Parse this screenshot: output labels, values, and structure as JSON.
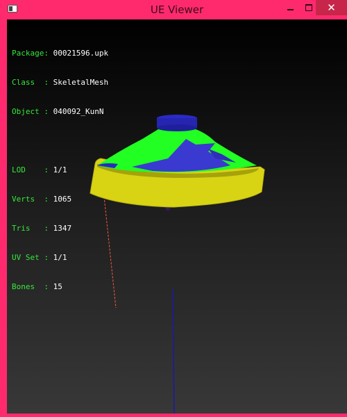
{
  "window": {
    "title": "UE Viewer"
  },
  "info": {
    "group1": [
      {
        "key": "Package:",
        "value": "00021596.upk"
      },
      {
        "key": "Class  :",
        "value": "SkeletalMesh"
      },
      {
        "key": "Object :",
        "value": "040092_KunN"
      }
    ],
    "group2": [
      {
        "key": "LOD    :",
        "value": "1/1"
      },
      {
        "key": "Verts  :",
        "value": "1065"
      },
      {
        "key": "Tris   :",
        "value": "1347"
      },
      {
        "key": "UV Set :",
        "value": "1/1"
      },
      {
        "key": "Bones  :",
        "value": "15"
      }
    ]
  },
  "colors": {
    "frame": "#ff2a6e",
    "label": "#36e83a",
    "mesh_green": "#22ff22",
    "mesh_blue": "#3a3ad0",
    "mesh_yellow": "#d8d414"
  }
}
